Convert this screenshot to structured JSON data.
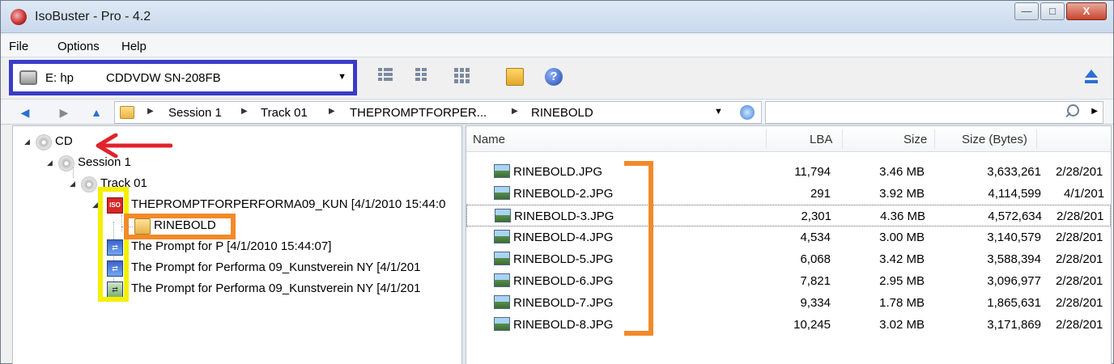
{
  "window": {
    "title": "IsoBuster - Pro - 4.2",
    "close_label": "X"
  },
  "menu": [
    "File",
    "Options",
    "Help"
  ],
  "drive": {
    "letter": "E: hp",
    "model": "CDDVDW SN-208FB"
  },
  "breadcrumb": [
    "Session 1",
    "Track 01",
    "THEPROMPTFORPER...",
    "RINEBOLD"
  ],
  "tree": [
    {
      "label": "CD",
      "icon": "cd-icon"
    },
    {
      "label": "Session 1",
      "icon": "cd-icon"
    },
    {
      "label": "Track 01",
      "icon": "cd-icon"
    },
    {
      "label": "THEPROMPTFORPERFORMA09_KUN [4/1/2010 15:44:0",
      "icon": "iso-icon",
      "icon_text": "ISO"
    },
    {
      "label": "RINEBOLD",
      "icon": "folder-icon"
    },
    {
      "label": "The Prompt for P [4/1/2010 15:44:07]",
      "icon": "file-icon"
    },
    {
      "label": "The Prompt for Performa 09_Kunstverein NY [4/1/201",
      "icon": "file-icon"
    },
    {
      "label": "The Prompt for Performa 09_Kunstverein NY [4/1/201",
      "icon": "file-icon"
    }
  ],
  "columns": {
    "name": "Name",
    "lba": "LBA",
    "size": "Size",
    "size_bytes": "Size (Bytes)"
  },
  "files": [
    {
      "name": "RINEBOLD.JPG",
      "lba": "11,794",
      "size": "3.46 MB",
      "bytes": "3,633,261",
      "date": "2/28/201"
    },
    {
      "name": "RINEBOLD-2.JPG",
      "lba": "291",
      "size": "3.92 MB",
      "bytes": "4,114,599",
      "date": "4/1/201"
    },
    {
      "name": "RINEBOLD-3.JPG",
      "lba": "2,301",
      "size": "4.36 MB",
      "bytes": "4,572,634",
      "date": "2/28/201"
    },
    {
      "name": "RINEBOLD-4.JPG",
      "lba": "4,534",
      "size": "3.00 MB",
      "bytes": "3,140,579",
      "date": "2/28/201"
    },
    {
      "name": "RINEBOLD-5.JPG",
      "lba": "6,068",
      "size": "3.42 MB",
      "bytes": "3,588,394",
      "date": "2/28/201"
    },
    {
      "name": "RINEBOLD-6.JPG",
      "lba": "7,821",
      "size": "2.95 MB",
      "bytes": "3,096,977",
      "date": "2/28/201"
    },
    {
      "name": "RINEBOLD-7.JPG",
      "lba": "9,334",
      "size": "1.78 MB",
      "bytes": "1,865,631",
      "date": "2/28/201"
    },
    {
      "name": "RINEBOLD-8.JPG",
      "lba": "10,245",
      "size": "3.02 MB",
      "bytes": "3,171,869",
      "date": "2/28/201"
    }
  ],
  "colors": {
    "drive_highlight": "#3a3cc8",
    "annotation_yellow": "#f4ef00",
    "annotation_orange": "#f28a2a",
    "annotation_red": "#e1222b"
  }
}
